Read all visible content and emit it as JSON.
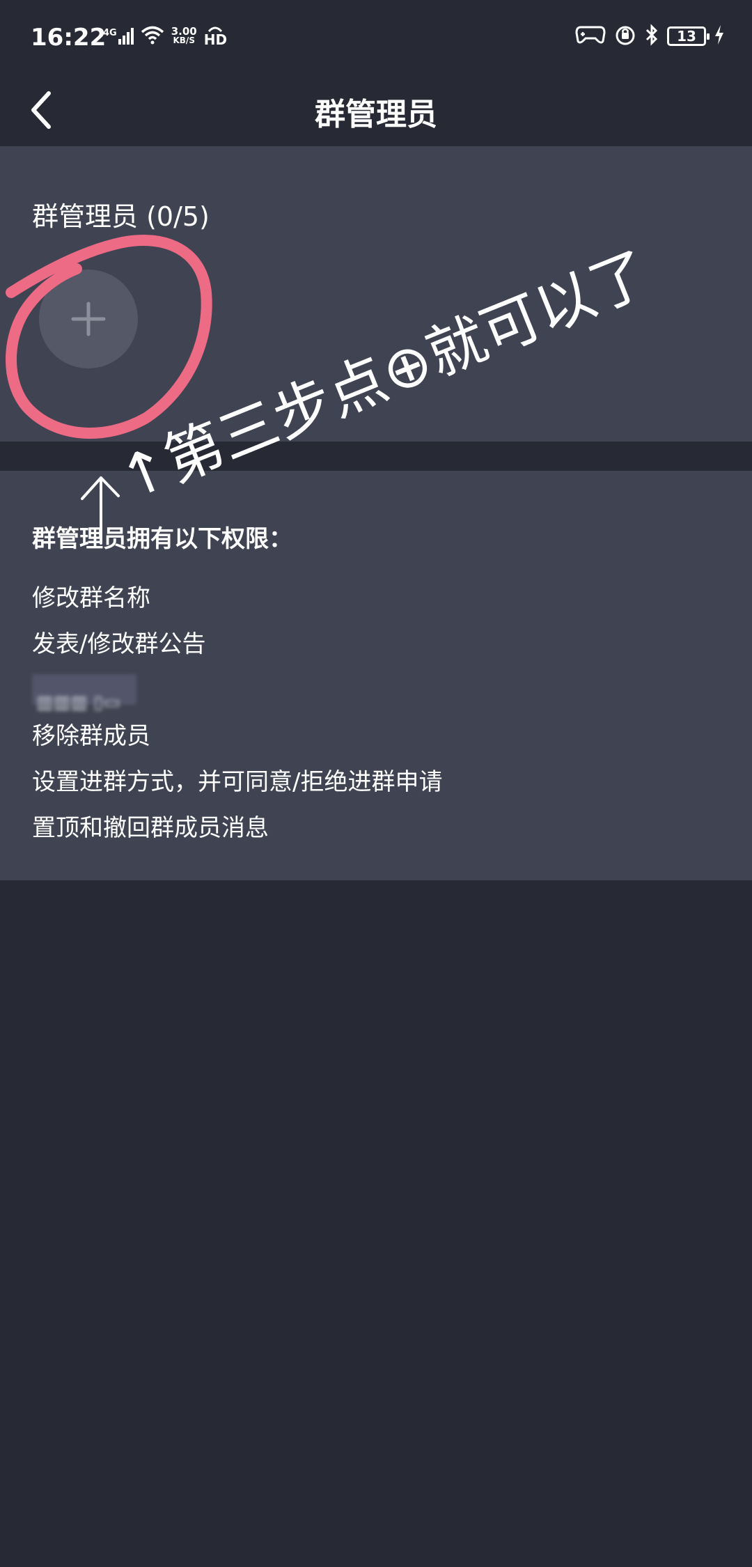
{
  "status_bar": {
    "time": "16:22",
    "signal_label": "4G",
    "net_speed_value": "3.00",
    "net_speed_unit": "KB/S",
    "hd_label": "HD",
    "battery_level": "13"
  },
  "header": {
    "title": "群管理员",
    "back_icon": "chevron-left-icon"
  },
  "admins": {
    "heading": "群管理员 (0/5)",
    "add_icon": "plus-icon"
  },
  "permissions": {
    "heading": "群管理员拥有以下权限：",
    "items": [
      "修改群名称",
      "发表/修改群公告",
      "",
      "移除群成员",
      "设置进群方式，并可同意/拒绝进群申请",
      "置顶和撤回群成员消息"
    ]
  },
  "annotation": {
    "text": "↑第三步点⊕就可以了",
    "circle_color": "#ee6b86"
  },
  "colors": {
    "background": "#272934",
    "panel": "#404351",
    "add_button": "#555866"
  }
}
